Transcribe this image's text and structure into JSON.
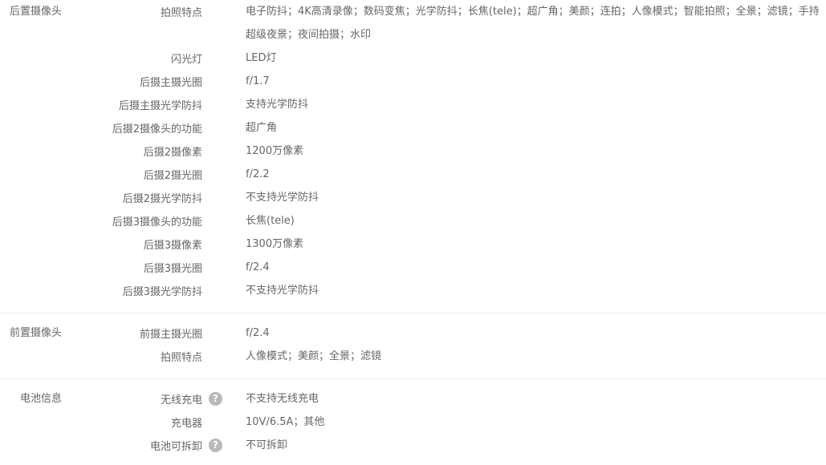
{
  "groups": [
    {
      "title": "后置摄像头",
      "rows": [
        {
          "label": "拍照特点",
          "value": "电子防抖；4K高清录像；数码变焦；光学防抖；长焦(tele)；超广角；美颜；连拍；人像模式；智能拍照；全景；滤镜；手持超级夜景；夜间拍摄；水印"
        },
        {
          "label": "闪光灯",
          "value": "LED灯"
        },
        {
          "label": "后摄主摄光圈",
          "value": "f/1.7"
        },
        {
          "label": "后摄主摄光学防抖",
          "value": "支持光学防抖"
        },
        {
          "label": "后摄2摄像头的功能",
          "value": "超广角"
        },
        {
          "label": "后摄2摄像素",
          "value": "1200万像素"
        },
        {
          "label": "后摄2摄光圈",
          "value": "f/2.2"
        },
        {
          "label": "后摄2摄光学防抖",
          "value": "不支持光学防抖"
        },
        {
          "label": "后摄3摄像头的功能",
          "value": "长焦(tele)"
        },
        {
          "label": "后摄3摄像素",
          "value": "1300万像素"
        },
        {
          "label": "后摄3摄光圈",
          "value": "f/2.4"
        },
        {
          "label": "后摄3摄光学防抖",
          "value": "不支持光学防抖"
        }
      ]
    },
    {
      "title": "前置摄像头",
      "rows": [
        {
          "label": "前摄主摄光圈",
          "value": "f/2.4"
        },
        {
          "label": "拍照特点",
          "value": "人像模式；美颜；全景；滤镜"
        }
      ]
    },
    {
      "title": "电池信息",
      "rows": [
        {
          "label": "无线充电",
          "value": "不支持无线充电",
          "icon": "question-circle-icon"
        },
        {
          "label": "充电器",
          "value": "10V/6.5A；其他"
        },
        {
          "label": "电池可拆卸",
          "value": "不可拆卸",
          "icon": "question-circle-icon"
        }
      ]
    }
  ]
}
